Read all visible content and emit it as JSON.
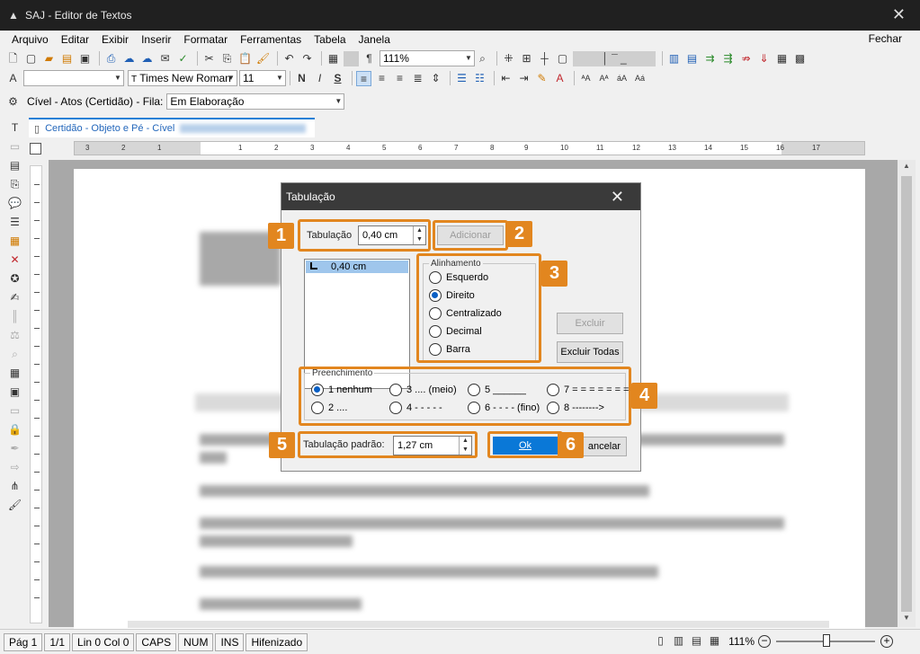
{
  "window": {
    "title": "SAJ - Editor de Textos"
  },
  "menu": {
    "items": [
      "Arquivo",
      "Editar",
      "Exibir",
      "Inserir",
      "Formatar",
      "Ferramentas",
      "Tabela",
      "Janela"
    ],
    "close_label": "Fechar"
  },
  "toolbar": {
    "zoom": "111%",
    "font_name": "Times New Roman",
    "font_size": "11",
    "bold": "N",
    "italic": "I",
    "strike": "S",
    "pilcrow": "¶"
  },
  "queue_bar": {
    "label": "Cível - Atos (Certidão) - Fila:",
    "queue_value": "Em Elaboração"
  },
  "document_tab": {
    "label": "Certidão - Objeto e Pé - Cível"
  },
  "ruler": {
    "labels": [
      "3",
      "2",
      "1",
      "1",
      "2",
      "3",
      "4",
      "5",
      "6",
      "7",
      "8",
      "9",
      "10",
      "11",
      "12",
      "13",
      "14",
      "15",
      "16",
      "17"
    ]
  },
  "dialog": {
    "title": "Tabulação",
    "tab_position_label": "Tabulação",
    "tab_position_value": "0,40 cm",
    "add_button": "Adicionar",
    "tab_list": [
      "0,40 cm"
    ],
    "alignment": {
      "legend": "Alinhamento",
      "options": [
        "Esquerdo",
        "Direito",
        "Centralizado",
        "Decimal",
        "Barra"
      ],
      "selected": "Direito"
    },
    "delete_button": "Excluir",
    "delete_all_button": "Excluir Todas",
    "fill": {
      "legend": "Preenchimento",
      "options": [
        "1 nenhum",
        "3 .... (meio)",
        "5 ______",
        "7 = = = = = = =",
        "2 ....",
        "4 - - - - -",
        "6 - - - - (fino)",
        "8 -------->"
      ],
      "selected": "1 nenhum"
    },
    "default_tab_label": "Tabulação padrão:",
    "default_tab_value": "1,27 cm",
    "ok_button": "Ok",
    "cancel_button": "ancelar"
  },
  "callouts": [
    "1",
    "2",
    "3",
    "4",
    "5",
    "6"
  ],
  "status": {
    "page": "Pág 1",
    "pages": "1/1",
    "position": "Lin 0  Col 0",
    "caps": "CAPS",
    "num": "NUM",
    "ins": "INS",
    "hyphen": "Hifenizado",
    "zoom": "111%"
  },
  "colors": {
    "accent": "#e2861f",
    "primary_button": "#0a78d7",
    "title_bar": "#202020"
  }
}
